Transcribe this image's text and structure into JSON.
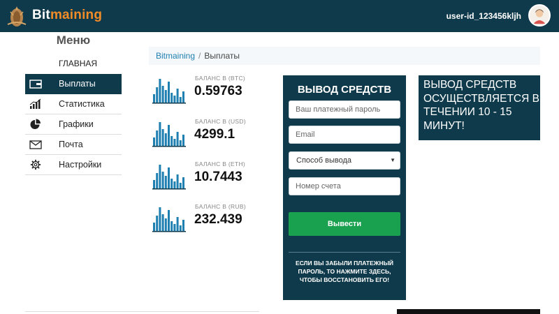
{
  "header": {
    "brand_part1": "Bit",
    "brand_part2": "maining",
    "user_id": "user-id_123456kljh",
    "brand_color": "#f28c28",
    "header_bg": "#0f3a4b"
  },
  "sidebar": {
    "title": "Меню",
    "home": "ГЛАВНАЯ",
    "items": [
      {
        "label": "Выплаты",
        "icon": "wallet-icon",
        "active": true
      },
      {
        "label": "Статистика",
        "icon": "bar-chart-icon",
        "active": false
      },
      {
        "label": "Графики",
        "icon": "pie-chart-icon",
        "active": false
      },
      {
        "label": "Почта",
        "icon": "envelope-icon",
        "active": false
      },
      {
        "label": "Настройки",
        "icon": "gear-icon",
        "active": false
      }
    ]
  },
  "breadcrumb": {
    "root": "Bitmaining",
    "separator": "/",
    "current": "Выплаты"
  },
  "balances": [
    {
      "label": "БАЛАНС В (BTC)",
      "value": "0.59763"
    },
    {
      "label": "БАЛАНС В (USD)",
      "value": "4299.1"
    },
    {
      "label": "БАЛАНС В (ETH)",
      "value": "10.7443"
    },
    {
      "label": "БАЛАНС В (RUB)",
      "value": "232.439"
    }
  ],
  "withdraw": {
    "title": "ВЫВОД СРЕДСТВ",
    "password_placeholder": "Ваш платежный пароль",
    "email_placeholder": "Email",
    "method_selected": "Способ вывода",
    "account_placeholder": "Номер счета",
    "submit_label": "Вывести",
    "forgot_text": "ЕСЛИ ВЫ ЗАБЫЛИ ПЛАТЕЖНЫЙ ПАРОЛЬ, ТО НАЖМИТЕ ЗДЕСЬ, ЧТОБЫ ВОССТАНОВИТЬ ЕГО!",
    "button_color": "#1aa14f"
  },
  "info": {
    "text": "ВЫВОД СРЕДСТВ ОСУЩЕСТВЛЯЕТСЯ В ТЕЧЕНИИ 10 - 15 МИНУТ!"
  }
}
